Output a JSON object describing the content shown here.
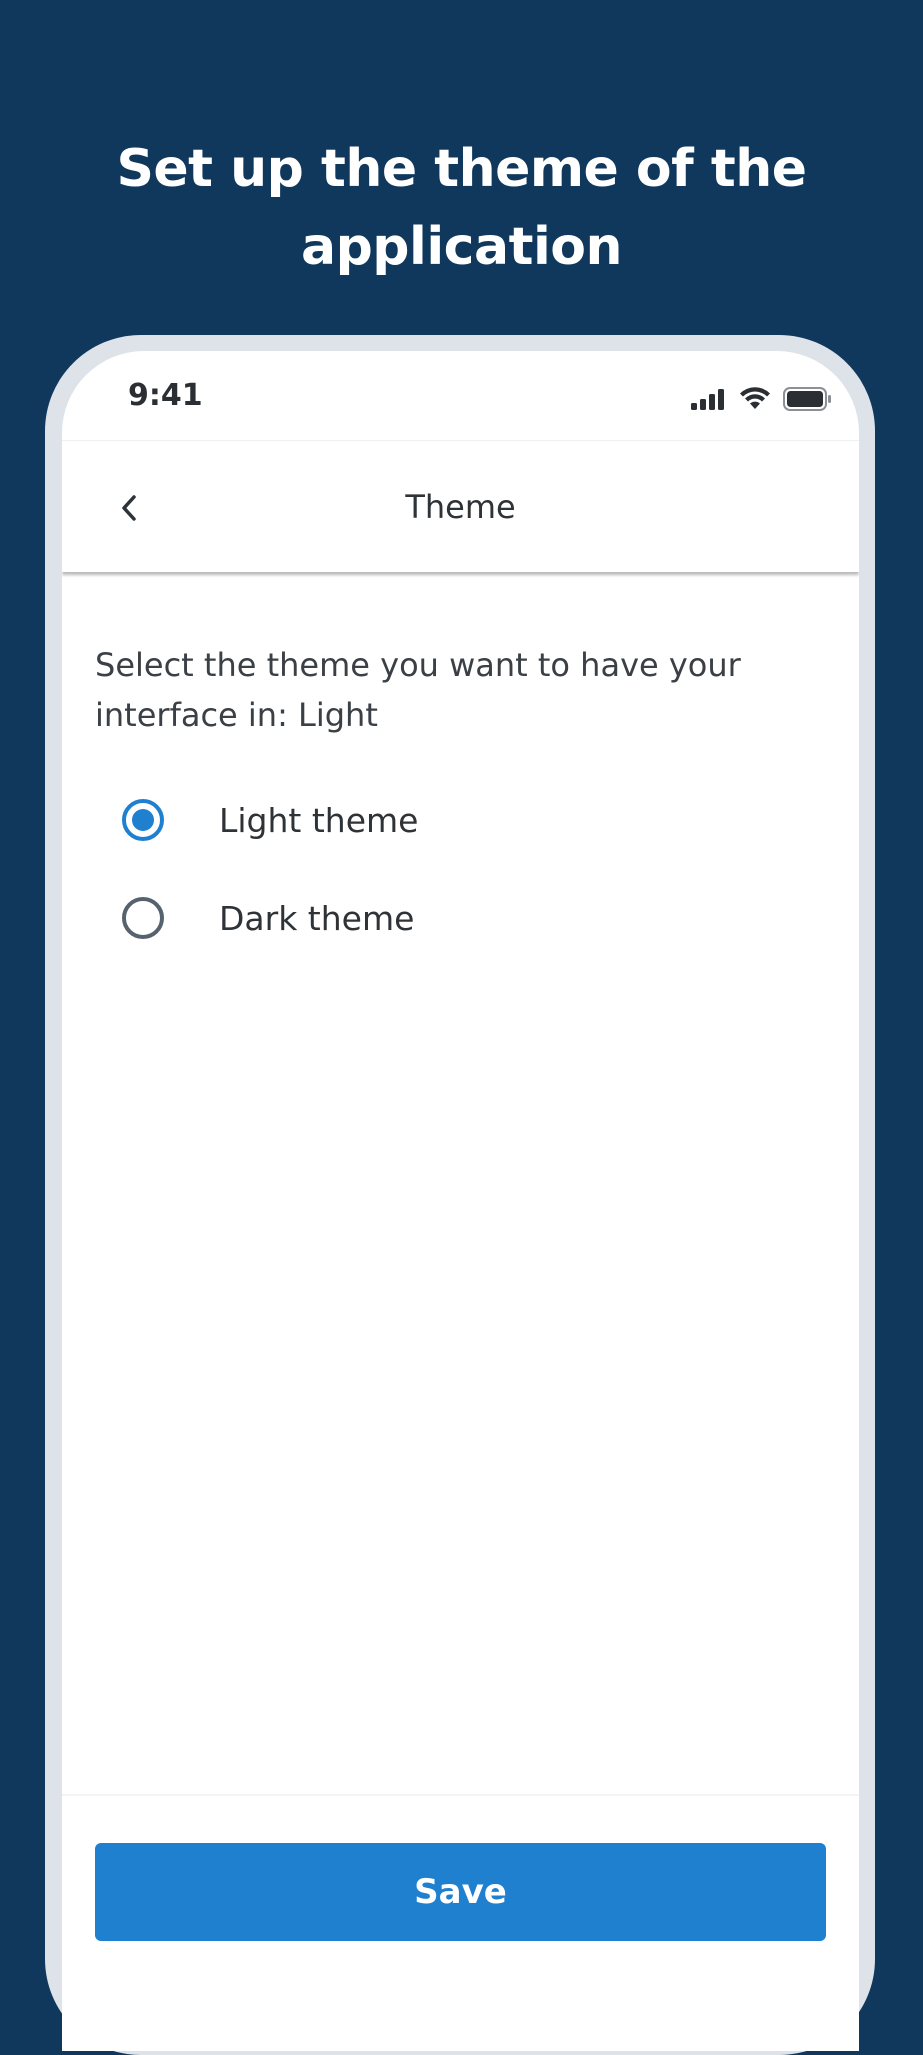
{
  "headline": {
    "line1": "Set up the theme of the",
    "line2": "application"
  },
  "status_bar": {
    "time": "9:41",
    "icons": [
      "signal-icon",
      "wifi-icon",
      "battery-icon"
    ]
  },
  "app_bar": {
    "title": "Theme",
    "back_icon": "chevron-left-icon"
  },
  "theme_settings": {
    "prompt": "Select the theme you want to have your interface in: Light",
    "options": [
      {
        "label": "Light theme",
        "selected": true
      },
      {
        "label": "Dark theme",
        "selected": false
      }
    ]
  },
  "footer": {
    "save_label": "Save"
  },
  "colors": {
    "background": "#0f385c",
    "accent": "#1f80d0",
    "device_frame": "#dde3e9"
  }
}
